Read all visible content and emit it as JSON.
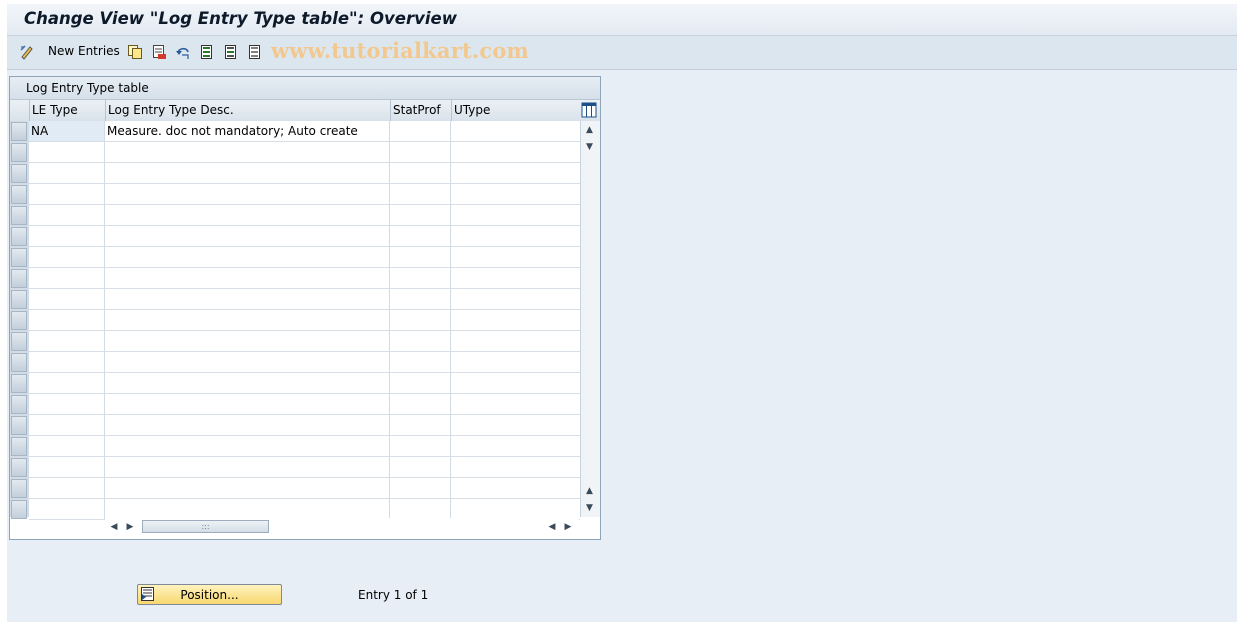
{
  "window": {
    "title": "Change View \"Log Entry Type table\": Overview"
  },
  "toolbar": {
    "new_entries_label": "New Entries",
    "icons": [
      "change-display-icon",
      "copy-icon",
      "delete-icon",
      "undo-icon",
      "select-all-icon",
      "select-block-icon",
      "deselect-all-icon"
    ],
    "watermark": "www.tutorialkart.com"
  },
  "table": {
    "caption": "Log Entry Type table",
    "columns": [
      "LE Type",
      "Log Entry Type Desc.",
      "StatProf",
      "UType"
    ],
    "rows": [
      {
        "le_type": "NA",
        "desc": "Measure. doc not mandatory; Auto create",
        "statprof": "",
        "utype": ""
      }
    ]
  },
  "footer": {
    "position_button_label": "Position...",
    "entry_info": "Entry 1 of 1"
  },
  "colors": {
    "button": "#f7d76f",
    "background": "#e8eef5",
    "watermark": "#f3c88e"
  }
}
